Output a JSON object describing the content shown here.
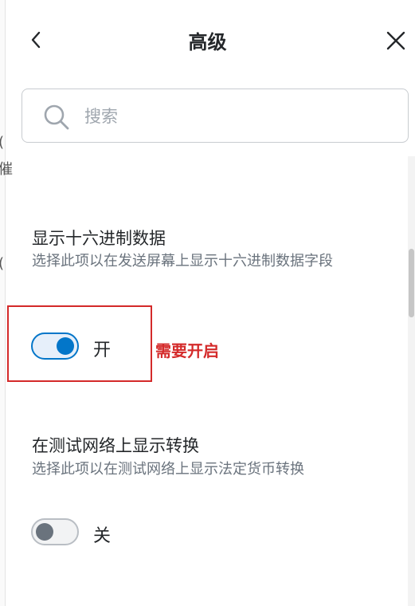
{
  "header": {
    "title": "高级",
    "back_icon": "chevron-left-icon",
    "close_icon": "close-icon"
  },
  "search": {
    "placeholder": "搜索",
    "value": "",
    "icon": "search-icon"
  },
  "left_fragments": [
    "(",
    "催",
    "("
  ],
  "settings": [
    {
      "title": "显示十六进制数据",
      "description": "选择此项以在发送屏幕上显示十六进制数据字段",
      "toggle": {
        "state": true,
        "label": "开"
      }
    },
    {
      "title": "在测试网络上显示转换",
      "description": "选择此项以在测试网络上显示法定货币转换",
      "toggle": {
        "state": false,
        "label": "关"
      }
    }
  ],
  "annotation": {
    "text": "需要开启",
    "color": "#d42a2a"
  },
  "colors": {
    "accent": "#0376c9",
    "text": "#24272a",
    "muted": "#6a737d",
    "annotation": "#d42a2a"
  }
}
